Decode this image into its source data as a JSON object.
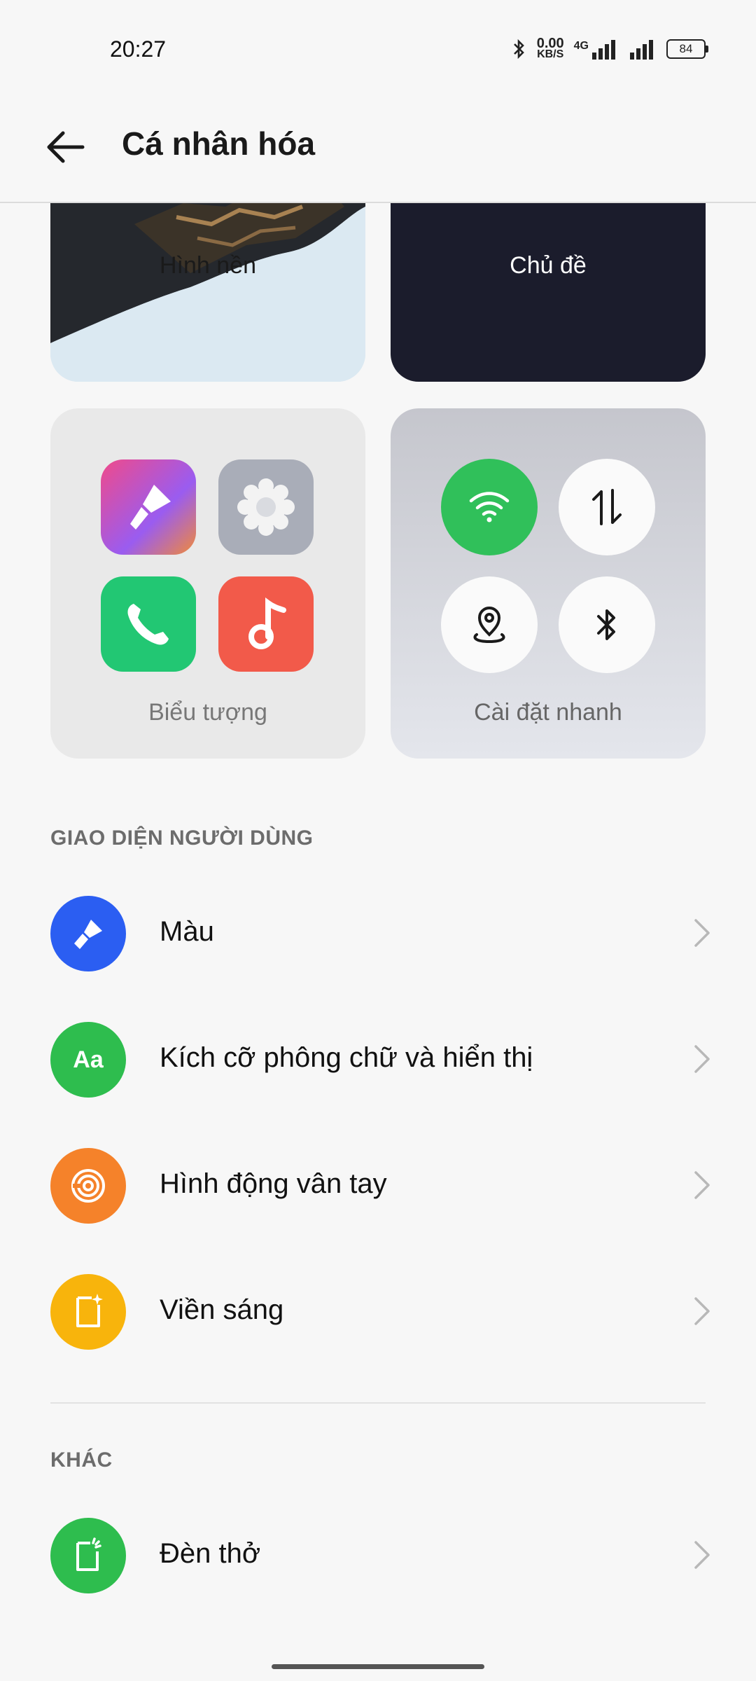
{
  "status_bar": {
    "time": "20:27",
    "net_speed_value": "0.00",
    "net_speed_unit": "KB/S",
    "network_type": "4G",
    "battery": "84",
    "icons": [
      "bluetooth-icon",
      "signal-icon",
      "signal-icon",
      "battery-icon"
    ]
  },
  "header": {
    "title": "Cá nhân hóa",
    "back_icon": "back-arrow-icon"
  },
  "tiles": {
    "wallpaper": "Hình nền",
    "theme": "Chủ đề",
    "icons": "Biểu tượng",
    "quick_settings": "Cài đặt nhanh"
  },
  "sections": {
    "ui": {
      "title": "GIAO DIỆN NGƯỜI DÙNG",
      "items": [
        {
          "label": "Màu",
          "icon": "paint-brush-icon",
          "color": "#2b5ef2"
        },
        {
          "label": "Kích cỡ phông chữ và hiển thị",
          "icon": "font-size-icon",
          "icon_text": "Aa",
          "color": "#2ebd4e"
        },
        {
          "label": "Hình động vân tay",
          "icon": "fingerprint-icon",
          "color": "#f5822a"
        },
        {
          "label": "Viền sáng",
          "icon": "edge-light-icon",
          "color": "#f8b40c"
        }
      ]
    },
    "other": {
      "title": "KHÁC",
      "items": [
        {
          "label": "Đèn thở",
          "icon": "breathing-light-icon",
          "color": "#2ebd4e"
        }
      ]
    }
  }
}
